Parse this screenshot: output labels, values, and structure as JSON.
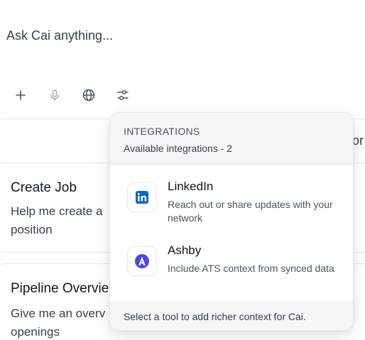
{
  "prompt": {
    "placeholder": "Ask Cai anything..."
  },
  "toolbar": {
    "buttons": [
      {
        "icon": "plus-icon"
      },
      {
        "icon": "microphone-icon"
      },
      {
        "icon": "globe-icon"
      },
      {
        "icon": "sliders-icon"
      }
    ]
  },
  "background": {
    "edge_fragment": "or",
    "cards": [
      {
        "title": "Create Job",
        "desc_line1": "Help me create a",
        "desc_line2": "position"
      },
      {
        "title": "Pipeline Overvie",
        "desc_line1": "Give me an overv",
        "desc_line2": "openings"
      }
    ]
  },
  "integrations_menu": {
    "heading": "INTEGRATIONS",
    "subheading": "Available integrations - 2",
    "items": [
      {
        "name": "LinkedIn",
        "description": "Reach out or share updates with your network",
        "icon": "linkedin-icon",
        "color": "#0a66c2"
      },
      {
        "name": "Ashby",
        "description": "Include ATS context from synced data",
        "icon": "ashby-icon",
        "color": "#4f46e5"
      }
    ],
    "footer": "Select a tool to add richer context for Cai."
  }
}
